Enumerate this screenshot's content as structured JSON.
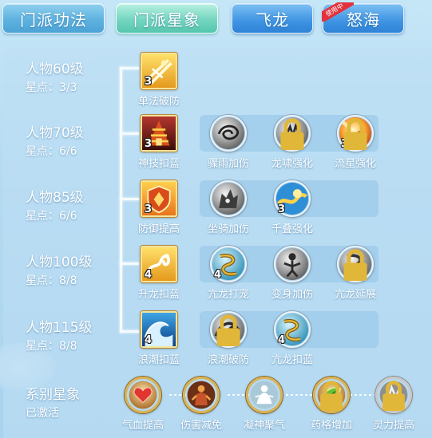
{
  "tabs": [
    {
      "label": "门派功法"
    },
    {
      "label": "门派星象"
    },
    {
      "label": "飞龙"
    },
    {
      "label": "怒海",
      "badge": "使用中"
    }
  ],
  "rows": [
    {
      "title": "人物60级",
      "stars": "星点：3/3"
    },
    {
      "title": "人物70级",
      "stars": "星点：6/6"
    },
    {
      "title": "人物85级",
      "stars": "星点：6/6"
    },
    {
      "title": "人物100级",
      "stars": "星点：8/8"
    },
    {
      "title": "人物115级",
      "stars": "星点：8/8"
    },
    {
      "title": "系别星象",
      "stars": "已激活"
    }
  ],
  "nodes": {
    "r0": [
      {
        "label": "单法破防",
        "level": "3",
        "icon": "crossed-blades-icon"
      }
    ],
    "r1": [
      {
        "label": "神技扣蓝",
        "level": "3",
        "icon": "fiery-pagoda-icon"
      },
      {
        "label": "骤雨加伤",
        "level": "",
        "icon": "swirl-storm-icon"
      },
      {
        "label": "龙啸强化",
        "level": "",
        "icon": "dragon-claw-icon"
      },
      {
        "label": "流星强化",
        "level": "3",
        "icon": "meteor-icon"
      }
    ],
    "r2": [
      {
        "label": "防御提高",
        "level": "3",
        "icon": "shield-icon"
      },
      {
        "label": "坐骑加伤",
        "level": "",
        "icon": "mount-beast-icon"
      },
      {
        "label": "千叠强化",
        "level": "3",
        "icon": "wave-surge-icon"
      }
    ],
    "r3": [
      {
        "label": "升龙扣蓝",
        "level": "4",
        "icon": "rising-dragon-icon"
      },
      {
        "label": "亢龙打宠",
        "level": "4",
        "icon": "coiled-dragon-icon"
      },
      {
        "label": "变身加伤",
        "level": "",
        "icon": "transform-figure-icon"
      },
      {
        "label": "亢龙延展",
        "level": "",
        "icon": "grey-dragon-icon"
      }
    ],
    "r4": [
      {
        "label": "浪潮扣蓝",
        "level": "4",
        "icon": "tidal-wave-icon"
      },
      {
        "label": "浪潮破防",
        "level": "",
        "icon": "wave-break-icon"
      },
      {
        "label": "亢龙扣蓝",
        "level": "4",
        "icon": "dragon-coil-icon"
      }
    ],
    "r5": [
      {
        "label": "气血提高",
        "icon": "heart-icon"
      },
      {
        "label": "伤害减免",
        "icon": "guardian-figure-icon"
      },
      {
        "label": "凝神聚气",
        "icon": "meditating-figure-icon"
      },
      {
        "label": "药格增加",
        "icon": "herb-leaf-icon"
      },
      {
        "label": "灵力提高",
        "icon": "spirit-rune-icon"
      }
    ]
  },
  "colors": {
    "tab_main": "#5eb2df",
    "tab_active": "#74d6c0",
    "tab_sub": "#3f94e2",
    "badge": "#e2333d",
    "panel": "#bedef4"
  }
}
